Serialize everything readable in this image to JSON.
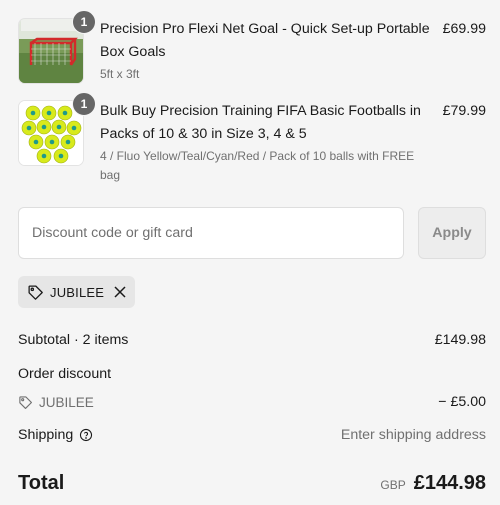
{
  "line_items": [
    {
      "quantity": "1",
      "title": "Precision Pro Flexi Net Goal - Quick Set-up Portable Box Goals",
      "variant": "5ft x 3ft",
      "price": "£69.99"
    },
    {
      "quantity": "1",
      "title": "Bulk Buy Precision Training FIFA Basic Footballs in Packs of 10 & 30 in Size 3, 4 & 5",
      "variant": "4 / Fluo Yellow/Teal/Cyan/Red / Pack of 10 balls with FREE bag",
      "price": "£79.99"
    }
  ],
  "discount": {
    "placeholder": "Discount code or gift card",
    "apply_label": "Apply",
    "applied_code": "JUBILEE"
  },
  "summary": {
    "subtotal_label": "Subtotal · 2 items",
    "subtotal_value": "£149.98",
    "order_discount_label": "Order discount",
    "discount_code": "JUBILEE",
    "discount_value": "− £5.00",
    "shipping_label": "Shipping",
    "shipping_value": "Enter shipping address",
    "total_label": "Total",
    "currency": "GBP",
    "total_value": "£144.98"
  },
  "icons": {
    "tag": "tag-icon",
    "close": "close-icon",
    "help": "help-circle-icon"
  },
  "colors": {
    "background": "#f5f5f5",
    "badge": "#666666",
    "muted_text": "#707070",
    "chip_background": "#e6e6e6"
  }
}
